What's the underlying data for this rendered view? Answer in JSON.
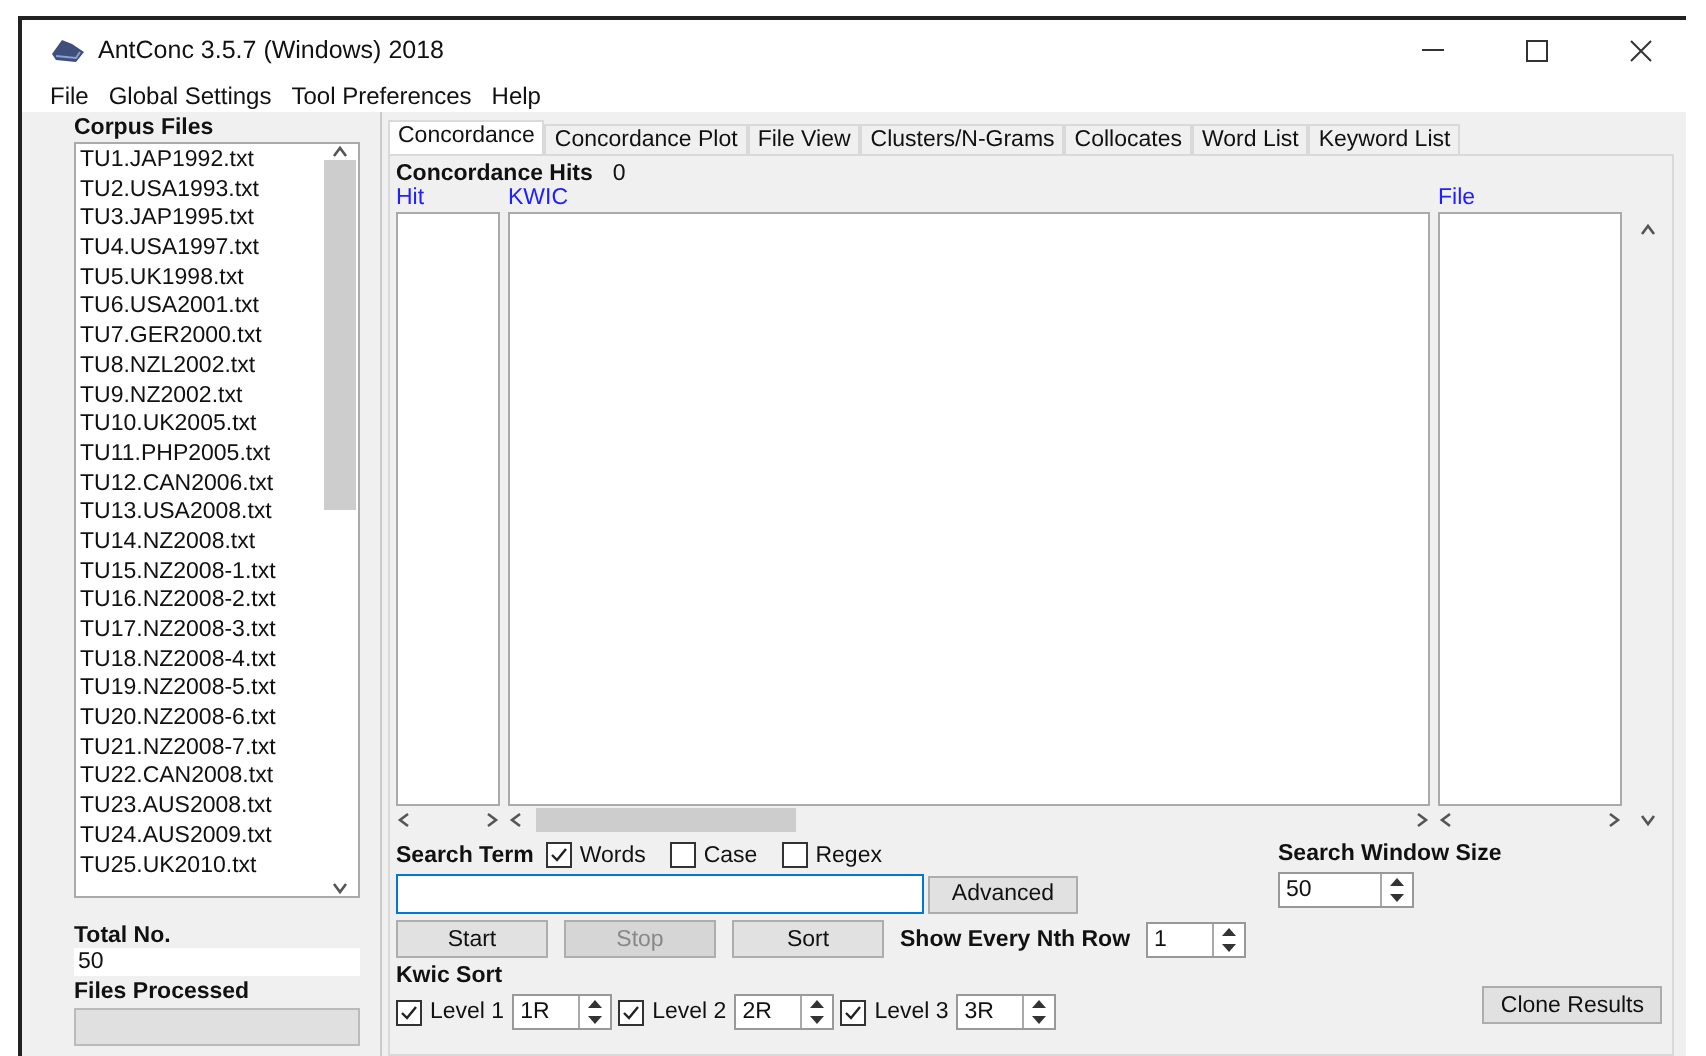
{
  "window": {
    "title": "AntConc 3.5.7 (Windows) 2018"
  },
  "menu": [
    "File",
    "Global Settings",
    "Tool Preferences",
    "Help"
  ],
  "corpus": {
    "label": "Corpus Files",
    "files": [
      "TU1.JAP1992.txt",
      "TU2.USA1993.txt",
      "TU3.JAP1995.txt",
      "TU4.USA1997.txt",
      "TU5.UK1998.txt",
      "TU6.USA2001.txt",
      "TU7.GER2000.txt",
      "TU8.NZL2002.txt",
      "TU9.NZ2002.txt",
      "TU10.UK2005.txt",
      "TU11.PHP2005.txt",
      "TU12.CAN2006.txt",
      "TU13.USA2008.txt",
      "TU14.NZ2008.txt",
      "TU15.NZ2008-1.txt",
      "TU16.NZ2008-2.txt",
      "TU17.NZ2008-3.txt",
      "TU18.NZ2008-4.txt",
      "TU19.NZ2008-5.txt",
      "TU20.NZ2008-6.txt",
      "TU21.NZ2008-7.txt",
      "TU22.CAN2008.txt",
      "TU23.AUS2008.txt",
      "TU24.AUS2009.txt",
      "TU25.UK2010.txt"
    ],
    "total_label": "Total No.",
    "total_value": "50",
    "processed_label": "Files Processed",
    "progress": {
      "level": 0
    }
  },
  "tabs": [
    {
      "label": "Concordance",
      "selected": true
    },
    {
      "label": "Concordance Plot",
      "selected": false
    },
    {
      "label": "File View",
      "selected": false
    },
    {
      "label": "Clusters/N-Grams",
      "selected": false
    },
    {
      "label": "Collocates",
      "selected": false
    },
    {
      "label": "Word List",
      "selected": false
    },
    {
      "label": "Keyword List",
      "selected": false
    }
  ],
  "hits": {
    "label": "Concordance Hits",
    "value": "0"
  },
  "columns": [
    "Hit",
    "KWIC",
    "File"
  ],
  "search": {
    "label": "Search Term",
    "options": [
      {
        "label": "Words",
        "checked": true
      },
      {
        "label": "Case",
        "checked": false
      },
      {
        "label": "Regex",
        "checked": false
      }
    ],
    "advanced": "Advanced"
  },
  "buttons": [
    {
      "label": "Start",
      "disabled": false
    },
    {
      "label": "Stop",
      "disabled": true
    },
    {
      "label": "Sort",
      "disabled": false
    }
  ],
  "nth_row": {
    "label": "Show Every Nth Row",
    "value": "1"
  },
  "window_size": {
    "label": "Search Window Size",
    "value": "50"
  },
  "kwic_sort": {
    "label": "Kwic Sort",
    "levels": [
      {
        "label": "Level 1",
        "checked": true,
        "value": "1R"
      },
      {
        "label": "Level 2",
        "checked": true,
        "value": "2R"
      },
      {
        "label": "Level 3",
        "checked": true,
        "value": "3R"
      }
    ]
  },
  "clone": "Clone Results"
}
